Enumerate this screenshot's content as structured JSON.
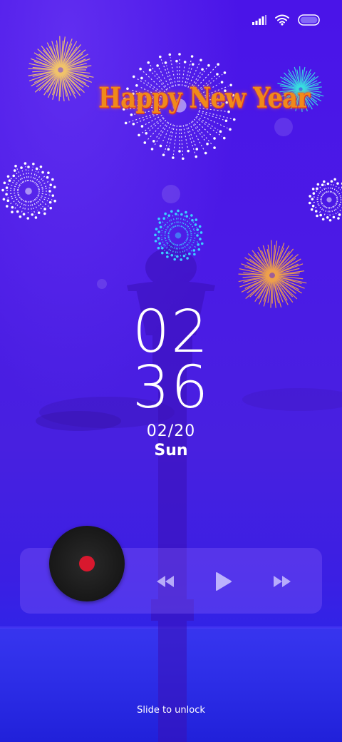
{
  "status_bar": {
    "signal_icon": "signal-icon",
    "wifi_icon": "wifi-icon",
    "battery_icon": "battery-icon"
  },
  "greeting": {
    "text": "Happy New Year"
  },
  "clock": {
    "hours": "02",
    "minutes": "36"
  },
  "date": {
    "date": "02/20",
    "weekday": "Sun"
  },
  "music_player": {
    "album_icon": "vinyl-record-icon",
    "prev_icon": "rewind-icon",
    "play_icon": "play-icon",
    "next_icon": "fast-forward-icon"
  },
  "unlock": {
    "label": "Slide to unlock"
  },
  "colors": {
    "background": "#4a14e8",
    "accent_record": "#d8182e",
    "greeting_text": "#f08a1a"
  }
}
